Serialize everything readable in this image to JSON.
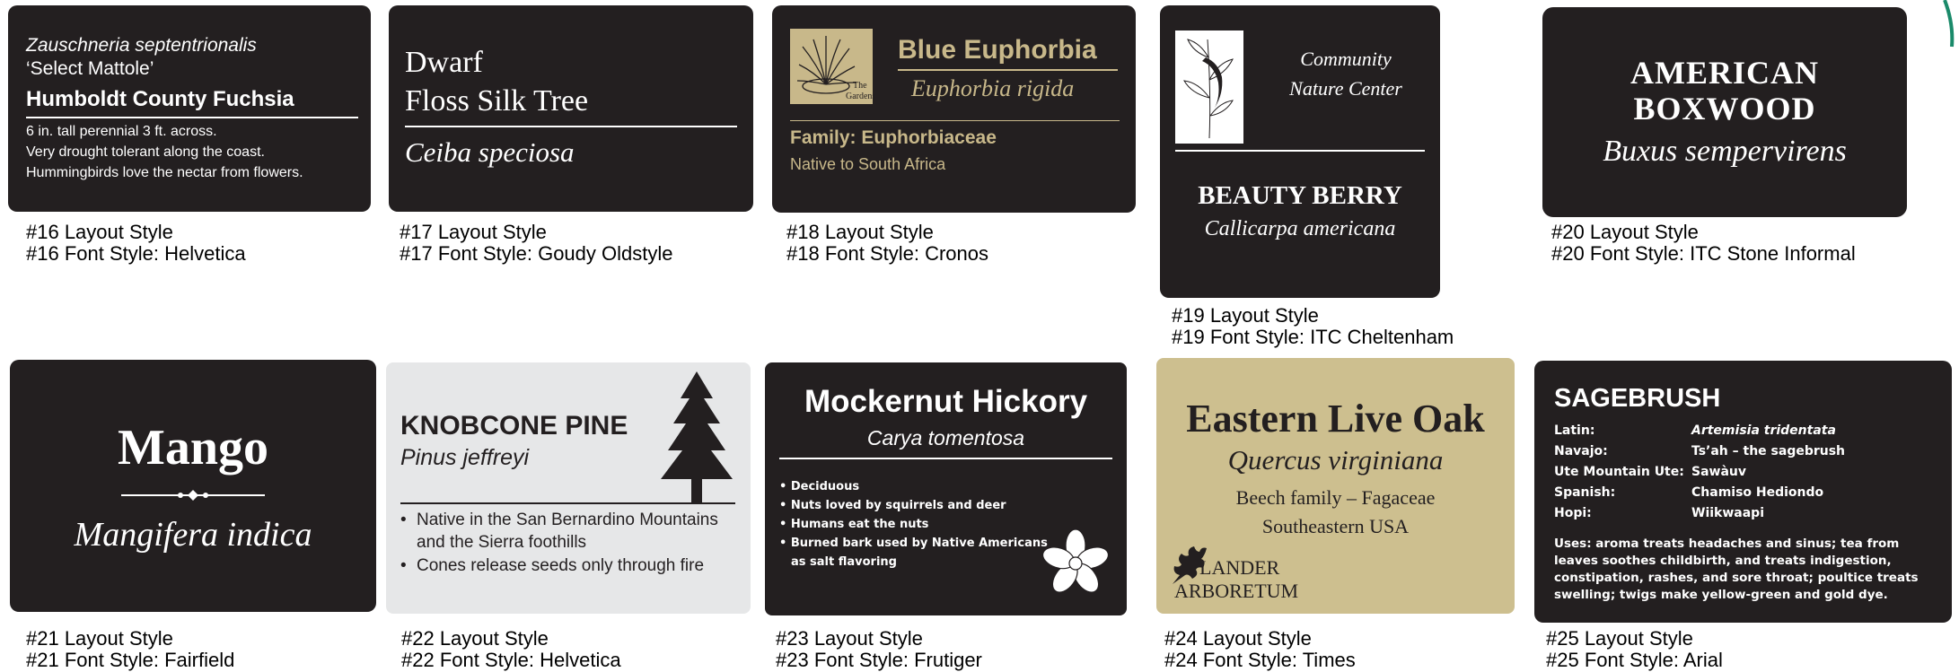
{
  "colors": {
    "sign_dark": "#231f20",
    "sign_gray": "#e6e7e8",
    "sign_tan": "#cdbf8f",
    "accent_gold": "#c8b88a",
    "accent_green": "#1a8a6a"
  },
  "signs": [
    {
      "id": 16,
      "lines": [
        "Zauschneria septentrionalis",
        "‘Select Mattole’",
        "Humboldt County Fuchsia",
        "6 in. tall perennial 3 ft. across.",
        "Very drought tolerant along the coast.",
        "Hummingbirds love the nectar from flowers."
      ],
      "layout_caption": "#16 Layout Style",
      "font_caption": "#16 Font Style: Helvetica"
    },
    {
      "id": 17,
      "lines": [
        "Dwarf",
        "Floss Silk Tree",
        "Ceiba speciosa"
      ],
      "layout_caption": "#17 Layout Style",
      "font_caption": "#17 Font Style: Goudy Oldstyle"
    },
    {
      "id": 18,
      "logo_text": [
        "The",
        "Gardens"
      ],
      "lines": [
        "Blue Euphorbia",
        "Euphorbia rigida",
        "Family:  Euphorbiaceae",
        "Native to South Africa"
      ],
      "layout_caption": "#18 Layout Style",
      "font_caption": "#18 Font Style: Cronos"
    },
    {
      "id": 19,
      "lines": [
        "Community",
        "Nature Center",
        "BEAUTY BERRY",
        "Callicarpa americana"
      ],
      "layout_caption": "#19 Layout Style",
      "font_caption": "#19 Font Style: ITC Cheltenham"
    },
    {
      "id": 20,
      "lines": [
        "AMERICAN",
        "BOXWOOD",
        "Buxus sempervirens"
      ],
      "layout_caption": "#20 Layout Style",
      "font_caption": "#20 Font Style: ITC Stone Informal"
    },
    {
      "id": 21,
      "lines": [
        "Mango",
        "Mangifera indica"
      ],
      "layout_caption": "#21 Layout Style",
      "font_caption": "#21 Font Style: Fairfield"
    },
    {
      "id": 22,
      "lines": [
        "KNOBCONE PINE",
        "Pinus jeffreyi",
        "Native in the San Bernardino Mountains",
        "and the Sierra foothills",
        "Cones release seeds only through fire"
      ],
      "layout_caption": "#22 Layout Style",
      "font_caption": "#22 Font Style: Helvetica"
    },
    {
      "id": 23,
      "lines": [
        "Mockernut Hickory",
        "Carya tomentosa",
        "Deciduous",
        "Nuts loved by squirrels and deer",
        "Humans eat the nuts",
        "Burned bark used by Native Americans",
        "as salt flavoring"
      ],
      "layout_caption": "#23 Layout Style",
      "font_caption": "#23 Font Style: Frutiger"
    },
    {
      "id": 24,
      "lines": [
        "Eastern Live Oak",
        "Quercus virginiana",
        "Beech family – Fagaceae",
        "Southeastern USA",
        "LANDER",
        "ARBORETUM"
      ],
      "layout_caption": "#24 Layout Style",
      "font_caption": "#24 Font Style: Times"
    },
    {
      "id": 25,
      "title": "SAGEBRUSH",
      "rows": [
        {
          "label": "Latin:",
          "value": "Artemisia tridentata"
        },
        {
          "label": "Navajo:",
          "value": "Ts’ah – the sagebrush"
        },
        {
          "label": "Ute Mountain Ute:",
          "value": "Sawàuv"
        },
        {
          "label": "Spanish:",
          "value": "Chamiso Hediondo"
        },
        {
          "label": "Hopi:",
          "value": "Wiikwaapi"
        }
      ],
      "uses": [
        "Uses:  aroma treats headaches and sinus; tea from",
        "leaves soothes childbirth, and treats indigestion,",
        "constipation, rashes, and sore throat; poultice treats",
        "swelling; twigs make yellow-green and gold dye."
      ],
      "layout_caption": "#25 Layout Style",
      "font_caption": "#25 Font Style: Arial"
    }
  ]
}
